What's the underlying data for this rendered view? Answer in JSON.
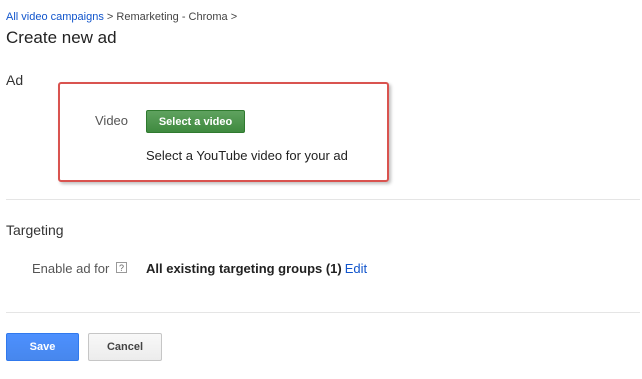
{
  "breadcrumb": {
    "link": "All video campaigns",
    "sep1": ">",
    "current": "Remarketing - Chroma",
    "sep2": ">"
  },
  "page": {
    "title": "Create new ad"
  },
  "ad_section": {
    "label": "Ad",
    "video_label": "Video",
    "select_button": "Select a video",
    "helper_text": "Select a YouTube video for your ad"
  },
  "targeting_section": {
    "label": "Targeting",
    "enable_label": "Enable ad for",
    "help_glyph": "?",
    "value": "All existing targeting groups (1)",
    "edit_link": "Edit"
  },
  "actions": {
    "save": "Save",
    "cancel": "Cancel"
  },
  "colors": {
    "link": "#1155cc",
    "green_button": "#4a944a",
    "blue_button": "#4d90fe",
    "highlight": "#d9534f"
  }
}
